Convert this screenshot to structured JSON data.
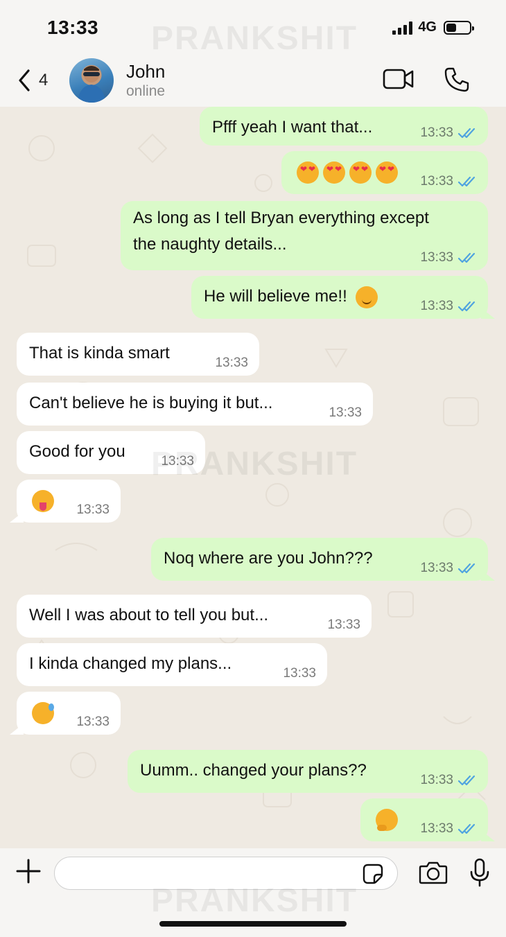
{
  "status_bar": {
    "time": "13:33",
    "network": "4G",
    "battery_level": 0.45
  },
  "watermark": "PRANKSHIT",
  "header": {
    "back_count": "4",
    "contact_name": "John",
    "contact_status": "online"
  },
  "messages": [
    {
      "id": "m1",
      "dir": "out",
      "text": "Pfff yeah I want that...",
      "time": "13:33",
      "ticks": "read"
    },
    {
      "id": "m2",
      "dir": "out",
      "emoji": [
        "smiling-face-with-heart-eyes",
        "smiling-face-with-heart-eyes",
        "smiling-face-with-heart-eyes",
        "smiling-face-with-heart-eyes"
      ],
      "time": "13:33",
      "ticks": "read"
    },
    {
      "id": "m3",
      "dir": "out",
      "text_lines": [
        "As long as I tell Bryan everything except",
        "the naughty details..."
      ],
      "time": "13:33",
      "ticks": "read"
    },
    {
      "id": "m4",
      "dir": "out",
      "text": "He will believe me!!",
      "emoji": [
        "relieved-face"
      ],
      "time": "13:33",
      "ticks": "read"
    },
    {
      "id": "m5",
      "dir": "in",
      "text": "That is kinda smart",
      "time": "13:33"
    },
    {
      "id": "m6",
      "dir": "in",
      "text": "Can't believe he is buying it but...",
      "time": "13:33"
    },
    {
      "id": "m7",
      "dir": "in",
      "text": "Good for you",
      "time": "13:33"
    },
    {
      "id": "m8",
      "dir": "in",
      "emoji": [
        "zany-face"
      ],
      "time": "13:33"
    },
    {
      "id": "m9",
      "dir": "out",
      "text": "Noq where are you John???",
      "time": "13:33",
      "ticks": "read"
    },
    {
      "id": "m10",
      "dir": "in",
      "text": "Well I was about to tell you but...",
      "time": "13:33"
    },
    {
      "id": "m11",
      "dir": "in",
      "text": "I kinda changed my plans...",
      "time": "13:33"
    },
    {
      "id": "m12",
      "dir": "in",
      "emoji": [
        "grinning-face-with-sweat"
      ],
      "time": "13:33"
    },
    {
      "id": "m13",
      "dir": "out",
      "text": "Uumm.. changed your plans??",
      "time": "13:33",
      "ticks": "read"
    },
    {
      "id": "m14",
      "dir": "out",
      "emoji": [
        "face-with-hand-over-mouth"
      ],
      "time": "13:33",
      "ticks": "read"
    }
  ],
  "input_bar": {
    "placeholder": ""
  },
  "colors": {
    "outgoing": "#dafac9",
    "incoming": "#ffffff",
    "read_ticks": "#4fa3e0",
    "chat_bg": "#efeae2"
  },
  "icons": {
    "header": [
      "chevron-left-icon",
      "video-camera-icon",
      "phone-icon"
    ],
    "input": [
      "plus-icon",
      "sticker-icon",
      "camera-icon",
      "microphone-icon"
    ]
  }
}
